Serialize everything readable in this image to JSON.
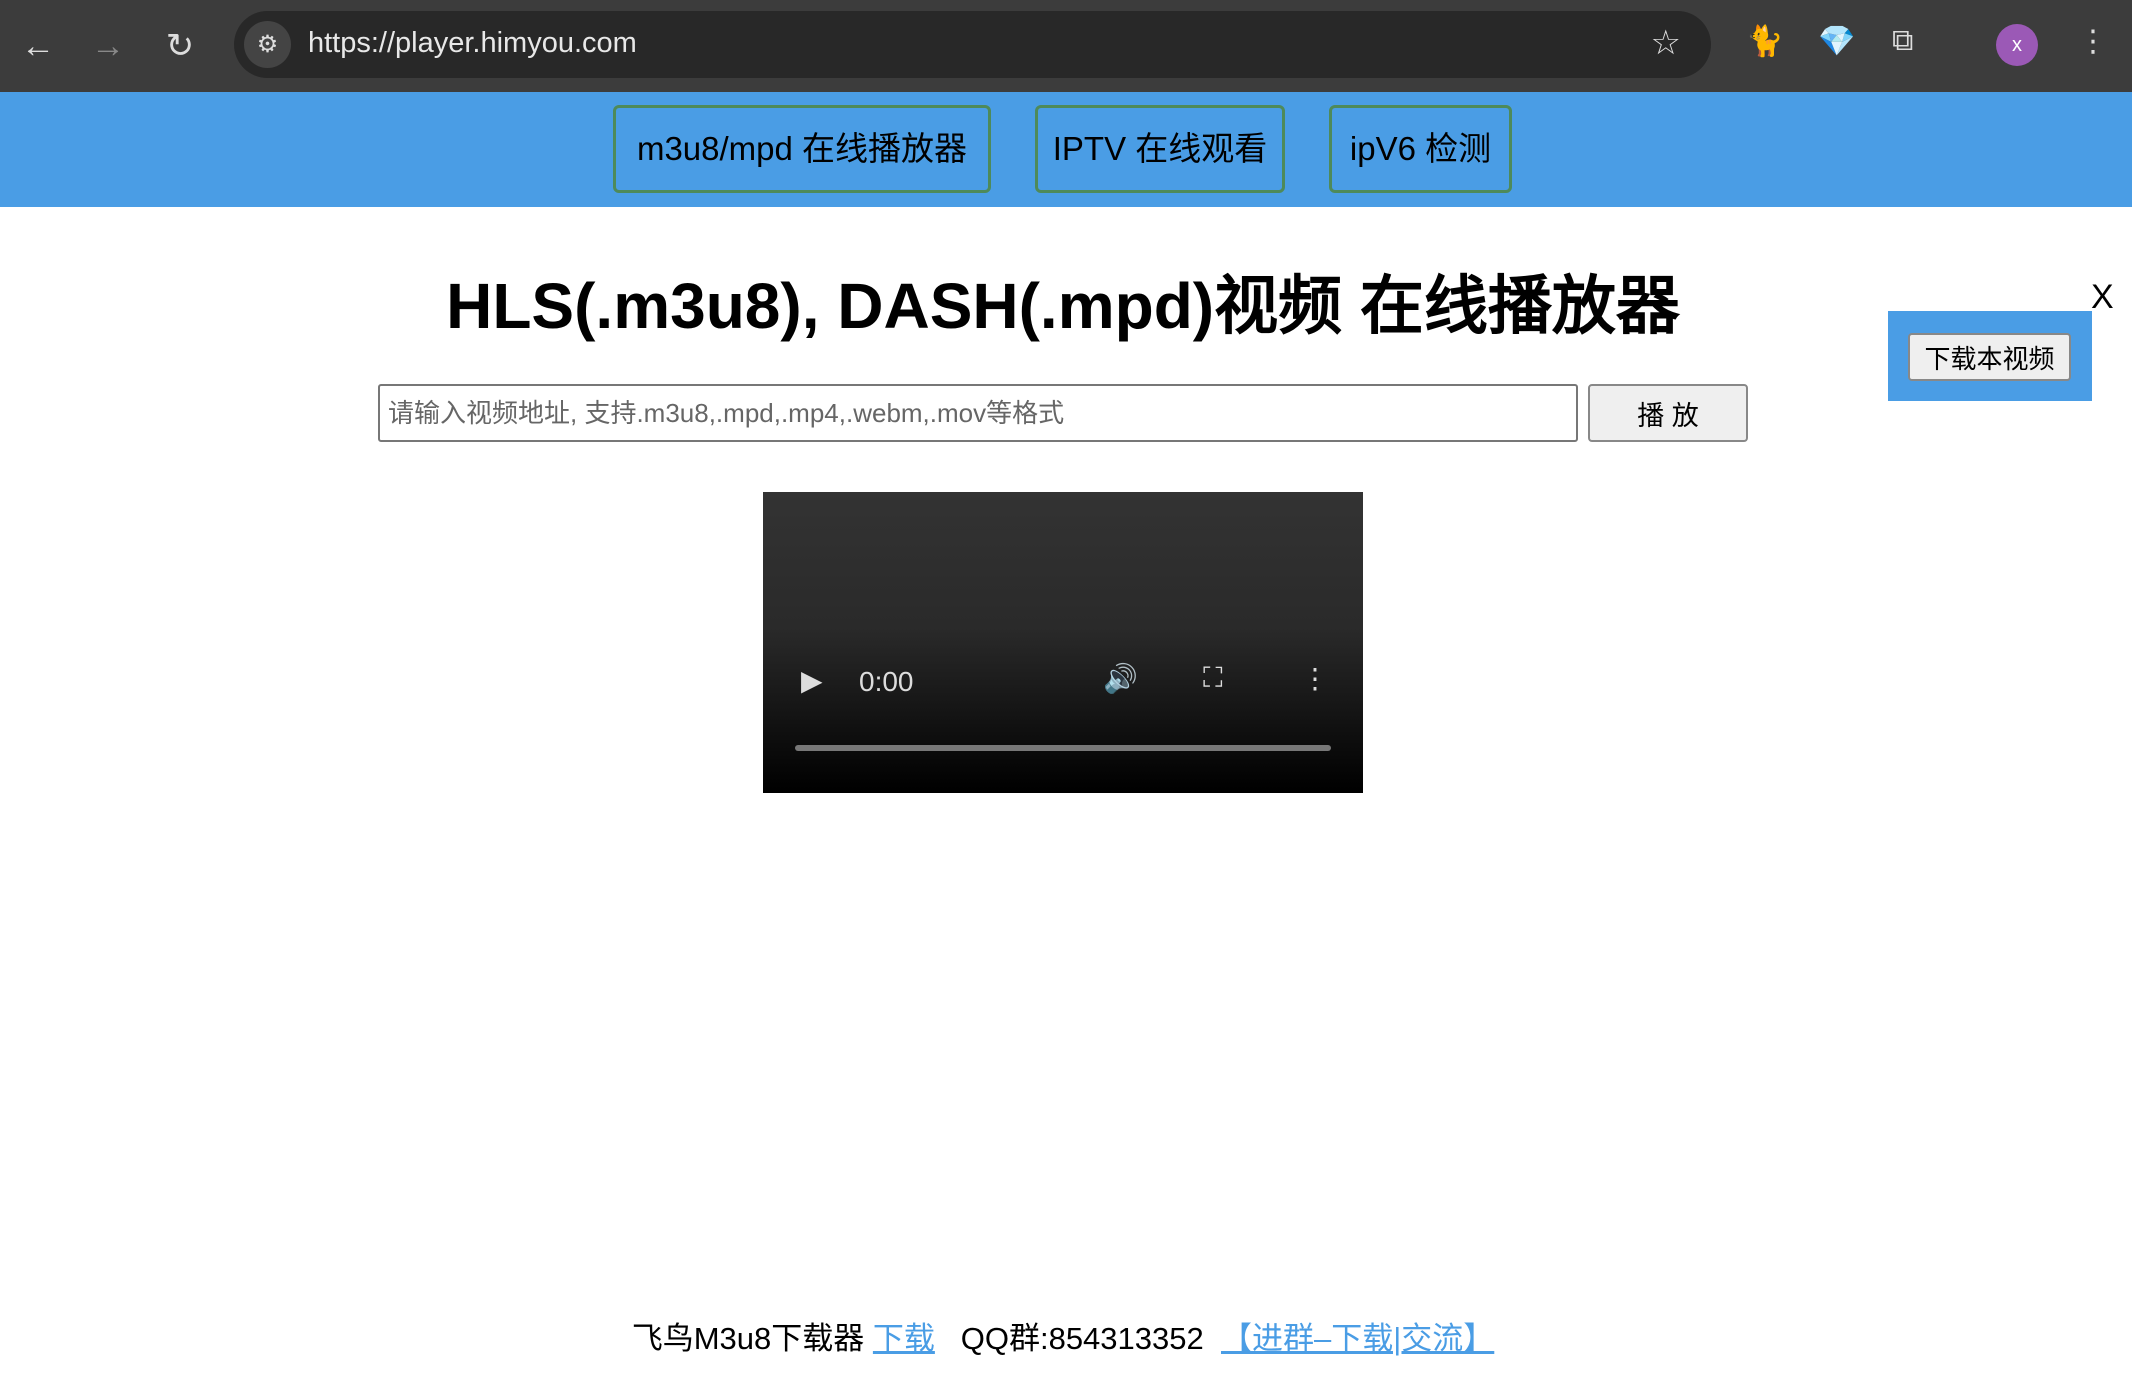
{
  "browser": {
    "url": "https://player.himyou.com",
    "profile_initial": "x"
  },
  "nav": [
    {
      "label": "m3u8/mpd 在线播放器"
    },
    {
      "label": "IPTV 在线观看"
    },
    {
      "label": "ipV6 检测"
    }
  ],
  "main": {
    "title": "HLS(.m3u8), DASH(.mpd)视频 在线播放器",
    "input_placeholder": "请输入视频地址, 支持.m3u8,.mpd,.mp4,.webm,.mov等格式",
    "input_value": "",
    "play_label": "播 放",
    "video": {
      "time": "0:00",
      "progress": 0
    }
  },
  "ad": {
    "download_label": "下载本视频",
    "close_label": "X"
  },
  "footer": {
    "app_name": "飞鸟M3u8下载器",
    "download_link": "下载",
    "qq_group": "QQ群:854313352",
    "group_link": "【进群–下载|交流】"
  }
}
